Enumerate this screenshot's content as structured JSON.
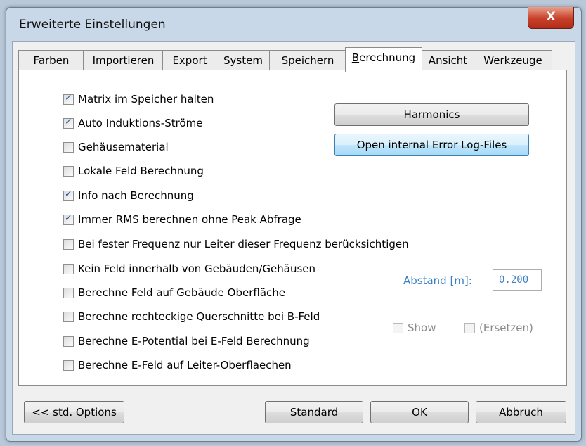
{
  "window": {
    "title": "Erweiterte Einstellungen",
    "close_label": "X"
  },
  "tabs": [
    {
      "label": "Farben",
      "mnemonic": "F",
      "rest": "arben",
      "active": false
    },
    {
      "label": "Importieren",
      "mnemonic": "I",
      "rest": "mportieren",
      "active": false
    },
    {
      "label": "Export",
      "mnemonic": "E",
      "rest": "xport",
      "active": false
    },
    {
      "label": "System",
      "mnemonic": "S",
      "rest": "ystem",
      "active": false
    },
    {
      "label": "Speichern",
      "mnemonic": "e",
      "pre": "Sp",
      "rest": "ichern",
      "active": false
    },
    {
      "label": "Berechnung",
      "mnemonic": "B",
      "rest": "erechnung",
      "active": true
    },
    {
      "label": "Ansicht",
      "mnemonic": "A",
      "rest": "nsicht",
      "active": false
    },
    {
      "label": "Werkzeuge",
      "mnemonic": "W",
      "rest": "erkzeuge",
      "active": false
    }
  ],
  "options": [
    {
      "label": "Matrix im Speicher halten",
      "checked": true
    },
    {
      "label": "Auto Induktions-Ströme",
      "checked": true
    },
    {
      "label": "Gehäusematerial",
      "checked": false
    },
    {
      "label": "Lokale Feld Berechnung",
      "checked": false
    },
    {
      "label": "Info nach Berechnung",
      "checked": true
    },
    {
      "label": "Immer RMS berechnen ohne Peak Abfrage",
      "checked": true
    },
    {
      "label": "Bei fester Frequenz nur Leiter dieser Frequenz berücksichtigen",
      "checked": false
    },
    {
      "label": "Kein Feld innerhalb von Gebäuden/Gehäusen",
      "checked": false
    },
    {
      "label": "Berechne Feld auf Gebäude Oberfläche",
      "checked": false
    },
    {
      "label": "Berechne rechteckige Querschnitte bei B-Feld",
      "checked": false
    },
    {
      "label": "Berechne E-Potential bei E-Feld Berechnung",
      "checked": false
    },
    {
      "label": "Berechne E-Feld auf Leiter-Oberflaechen",
      "checked": false
    }
  ],
  "side_buttons": {
    "harmonics": "Harmonics",
    "error_log": "Open internal Error Log-Files"
  },
  "abstand": {
    "label": "Abstand [m]:",
    "value": "0.200"
  },
  "extra_checks": {
    "show": {
      "label": "Show",
      "checked": false,
      "enabled": false
    },
    "ersetzen": {
      "label": "(Ersetzen)",
      "checked": false,
      "enabled": false
    }
  },
  "footer": {
    "std_options": "<< std. Options",
    "standard": "Standard",
    "ok": "OK",
    "abbruch": "Abbruch"
  }
}
